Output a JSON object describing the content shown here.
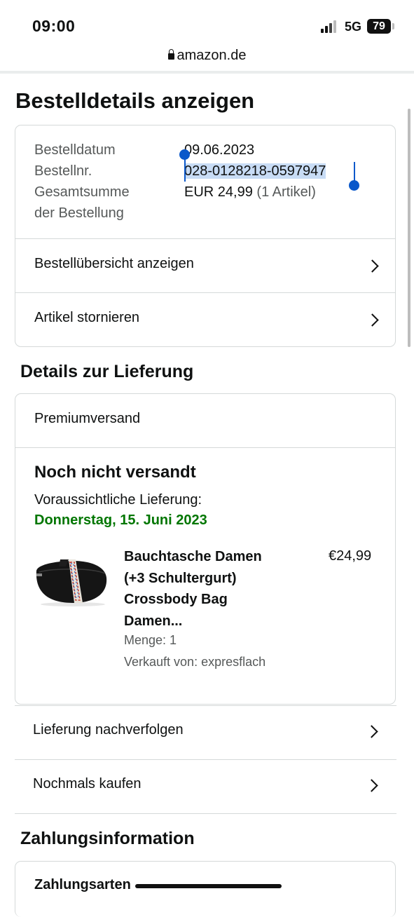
{
  "status_bar": {
    "time": "09:00",
    "network": "5G",
    "battery": "79"
  },
  "browser": {
    "url": "amazon.de"
  },
  "page": {
    "title": "Bestelldetails anzeigen"
  },
  "order_summary": {
    "date_label": "Bestelldatum",
    "date_value": "09.06.2023",
    "number_label": "Bestellnr.",
    "number_value": "028-0128218-0597947",
    "total_label_line1": "Gesamtsumme",
    "total_label_line2": "der Bestellung",
    "total_value": "EUR 24,99",
    "total_items": "(1 Artikel)",
    "actions": [
      {
        "label": "Bestellübersicht anzeigen",
        "icon": "chevron-right-icon"
      },
      {
        "label": "Artikel stornieren",
        "icon": "chevron-right-icon"
      }
    ]
  },
  "delivery": {
    "heading": "Details zur Lieferung",
    "shipping_method": "Premiumversand",
    "status": "Noch nicht versandt",
    "expected_label": "Voraussichtliche Lieferung:",
    "expected_date": "Donnerstag, 15. Juni 2023",
    "item": {
      "image": "black-belt-bag-product-image",
      "title_line1": "Bauchtasche Damen",
      "title_line2": "(+3 Schultergurt)",
      "title_line3": "Crossbody Bag",
      "title_line4": "Damen...",
      "price": "€24,99",
      "quantity": "Menge: 1",
      "seller": "Verkauft von: expresflach"
    },
    "actions": [
      {
        "label": "Lieferung nachverfolgen",
        "icon": "chevron-right-icon"
      },
      {
        "label": "Nochmals kaufen",
        "icon": "chevron-right-icon"
      }
    ]
  },
  "payment": {
    "heading": "Zahlungsinformation",
    "methods_label": "Zahlungsarten"
  },
  "colors": {
    "accent_green": "#007600",
    "selection": "#c8dcf5",
    "handle_blue": "#0a58ca",
    "border": "#d5d9d9"
  }
}
